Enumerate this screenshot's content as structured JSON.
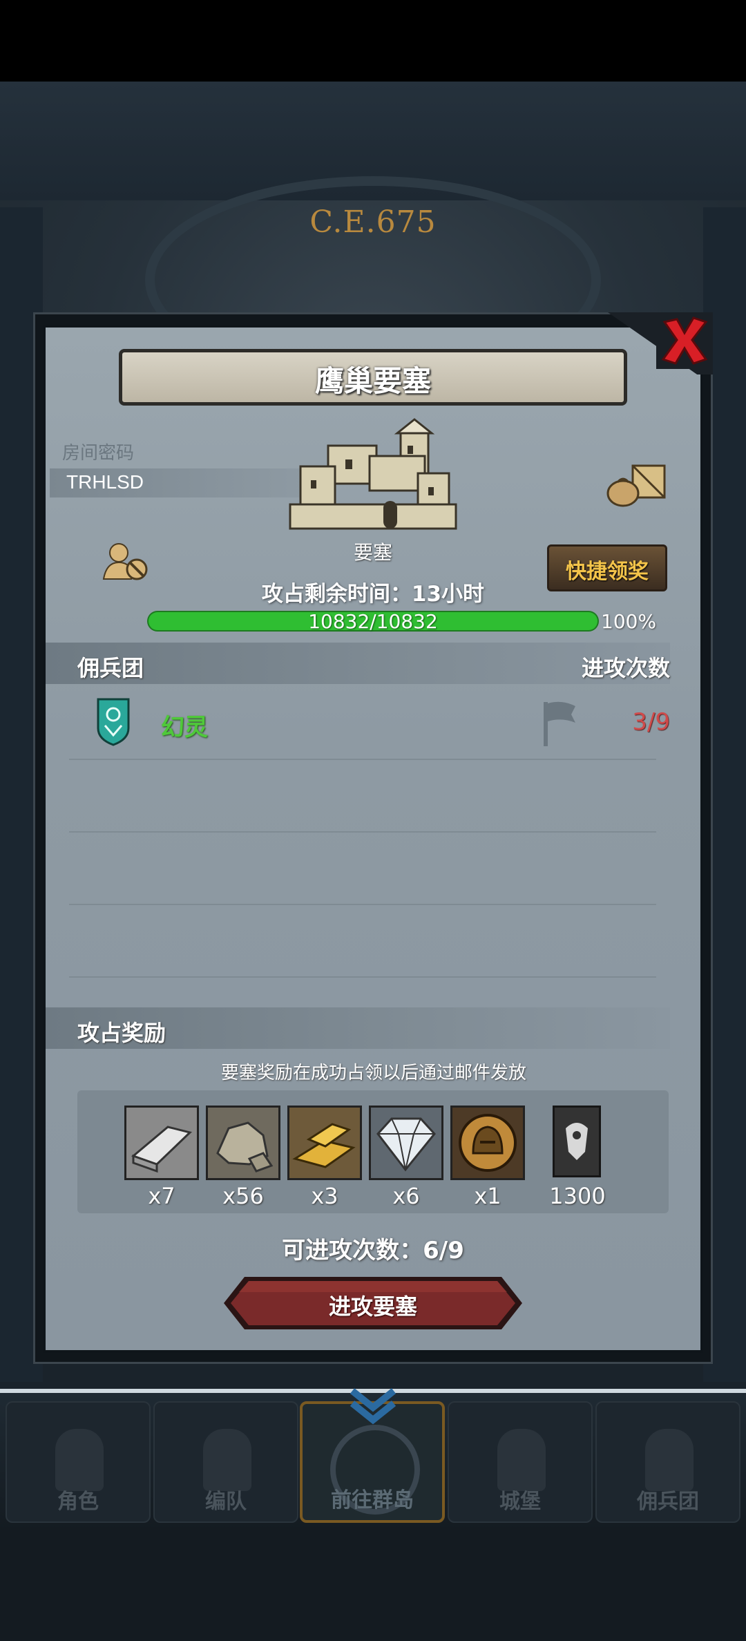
{
  "background": {
    "year": "C.E.675",
    "nav": [
      {
        "label": "角色"
      },
      {
        "label": "编队"
      },
      {
        "label": "前往群岛"
      },
      {
        "label": "城堡"
      },
      {
        "label": "佣兵团"
      }
    ]
  },
  "dialog": {
    "title": "鹰巢要塞",
    "room_password_label": "房间密码",
    "room_password": "TRHLSD",
    "castle_label": "要塞",
    "quick_claim": "快捷领奖",
    "time_remaining": "攻占剩余时间：13小时",
    "hp": {
      "text": "10832/10832",
      "percent_text": "100%",
      "fraction": 1.0
    },
    "guild_section": {
      "left": "佣兵团",
      "right": "进攻次数"
    },
    "guild": {
      "name": "幻灵",
      "attacks": "3/9"
    },
    "reward_section": "攻占奖励",
    "reward_note": "要塞奖励在成功占领以后通过邮件发放",
    "rewards": [
      {
        "icon": "silver-ingot-icon",
        "qty": "x7"
      },
      {
        "icon": "stone-icon",
        "qty": "x56"
      },
      {
        "icon": "gold-bars-icon",
        "qty": "x3"
      },
      {
        "icon": "diamond-icon",
        "qty": "x6"
      },
      {
        "icon": "knight-helmet-medal-icon",
        "qty": "x1"
      },
      {
        "icon": "banner-card-icon",
        "qty": "1300"
      }
    ],
    "attempts": "可进攻次数：6/9",
    "attack_button": "进攻要塞"
  },
  "colors": {
    "hp_green": "#2fbe32",
    "guild_green": "#4fc93a",
    "attack_count_red": "#d04a4a",
    "quick_claim_gold": "#f4c44a",
    "attack_button": "#7a2a2a"
  }
}
